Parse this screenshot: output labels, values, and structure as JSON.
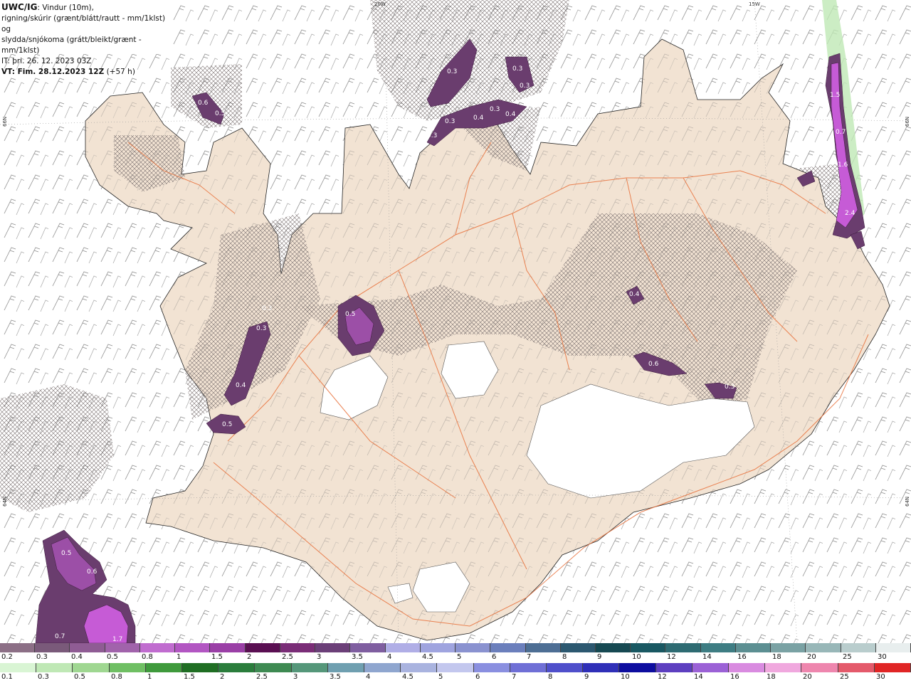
{
  "header": {
    "model": "UWC/IG",
    "desc1": ": Vindur (10m),",
    "desc2": "rigning/skúrir (grænt/blátt/rautt - mm/1klst) og",
    "desc3": "slydda/snjókoma (grátt/bleikt/grænt - mm/1klst)",
    "it": "IT: þri. 26. 12. 2023 03Z",
    "vt_label": "VT: Fim. 28.12.2023 12Z",
    "lead": " (+57 h)"
  },
  "grid_labels": {
    "lon_20w": "20W",
    "lon_15w": "15W",
    "lat_66n_left": "66N",
    "lat_66n_right": "66N",
    "lat_64n_left": "64N",
    "lat_64n_right": "64N"
  },
  "precip_labels": [
    {
      "id": "p1",
      "text": "0.6"
    },
    {
      "id": "p2",
      "text": "0.5"
    },
    {
      "id": "p3",
      "text": "0.3"
    },
    {
      "id": "p4",
      "text": "0.3"
    },
    {
      "id": "p5",
      "text": "0.3"
    },
    {
      "id": "p6",
      "text": "0.3"
    },
    {
      "id": "p7",
      "text": "0.4"
    },
    {
      "id": "p8",
      "text": "0.3"
    },
    {
      "id": "p9",
      "text": "0.4"
    },
    {
      "id": "p10",
      "text": "0.3"
    },
    {
      "id": "p11",
      "text": "0.3"
    },
    {
      "id": "p12",
      "text": "0.5"
    },
    {
      "id": "p13",
      "text": "0.3"
    },
    {
      "id": "p14",
      "text": "0.4"
    },
    {
      "id": "p15",
      "text": "0.5"
    },
    {
      "id": "p16",
      "text": "0.4"
    },
    {
      "id": "p17",
      "text": "0.6"
    },
    {
      "id": "p18",
      "text": "0.7"
    },
    {
      "id": "p19",
      "text": "1.6"
    },
    {
      "id": "p20",
      "text": "2.4"
    },
    {
      "id": "p21",
      "text": "1.5"
    },
    {
      "id": "p22",
      "text": "0.5"
    },
    {
      "id": "p23",
      "text": "0.6"
    },
    {
      "id": "p24",
      "text": "0.7"
    },
    {
      "id": "p25",
      "text": "1.7"
    },
    {
      "id": "p26",
      "text": "0.3"
    }
  ],
  "colors": {
    "land": "#f2e3d3",
    "roads": "#e8703a",
    "glacier": "#ffffff",
    "sea": "#ffffff",
    "precip_light": "#6a3d6e",
    "precip_mid": "#9c4fa7",
    "precip_heavy": "#c65bd6"
  },
  "legend_snow": {
    "labels": [
      "0.2",
      "0.3",
      "0.4",
      "0.5",
      "0.8",
      "1",
      "1.5",
      "2",
      "2.5",
      "3",
      "3.5",
      "4",
      "4.5",
      "5",
      "6",
      "7",
      "8",
      "9",
      "10",
      "12",
      "14",
      "16",
      "18",
      "20",
      "25",
      "30"
    ],
    "colors": [
      "#8c6f86",
      "#7a5a7a",
      "#8f5c94",
      "#a163ab",
      "#c06ccf",
      "#b256c2",
      "#9a3fa6",
      "#5a0f52",
      "#7a2d77",
      "#6b3f78",
      "#7f5ea0",
      "#b0aee6",
      "#9fa4df",
      "#8a92d0",
      "#6b7fbc",
      "#4d6e94",
      "#2c5870",
      "#164952",
      "#195862",
      "#2e6b72",
      "#3e7d83",
      "#5c8f92",
      "#7aa2a4",
      "#98b7b8",
      "#b9cdcd",
      "#e8eeee"
    ]
  },
  "legend_rain": {
    "labels": [
      "0.1",
      "0.3",
      "0.5",
      "0.8",
      "1",
      "1.5",
      "2",
      "2.5",
      "3",
      "3.5",
      "4",
      "4.5",
      "5",
      "6",
      "7",
      "8",
      "9",
      "10",
      "12",
      "14",
      "16",
      "18",
      "20",
      "25",
      "30"
    ],
    "colors": [
      "#d9f5d4",
      "#bfe8b5",
      "#9fd791",
      "#6fbf63",
      "#3f9a3c",
      "#1f6e23",
      "#2a7d3c",
      "#3e8a52",
      "#55977a",
      "#6f9fb0",
      "#8fa6cf",
      "#a9b3df",
      "#c3c7ee",
      "#8a8fe0",
      "#6f6fd6",
      "#4f4fcb",
      "#2f2fb8",
      "#0d0d9f",
      "#5d3fc0",
      "#9b61d6",
      "#d98be0",
      "#f0a8de",
      "#ee86ae",
      "#e45a6b",
      "#e02525"
    ]
  }
}
